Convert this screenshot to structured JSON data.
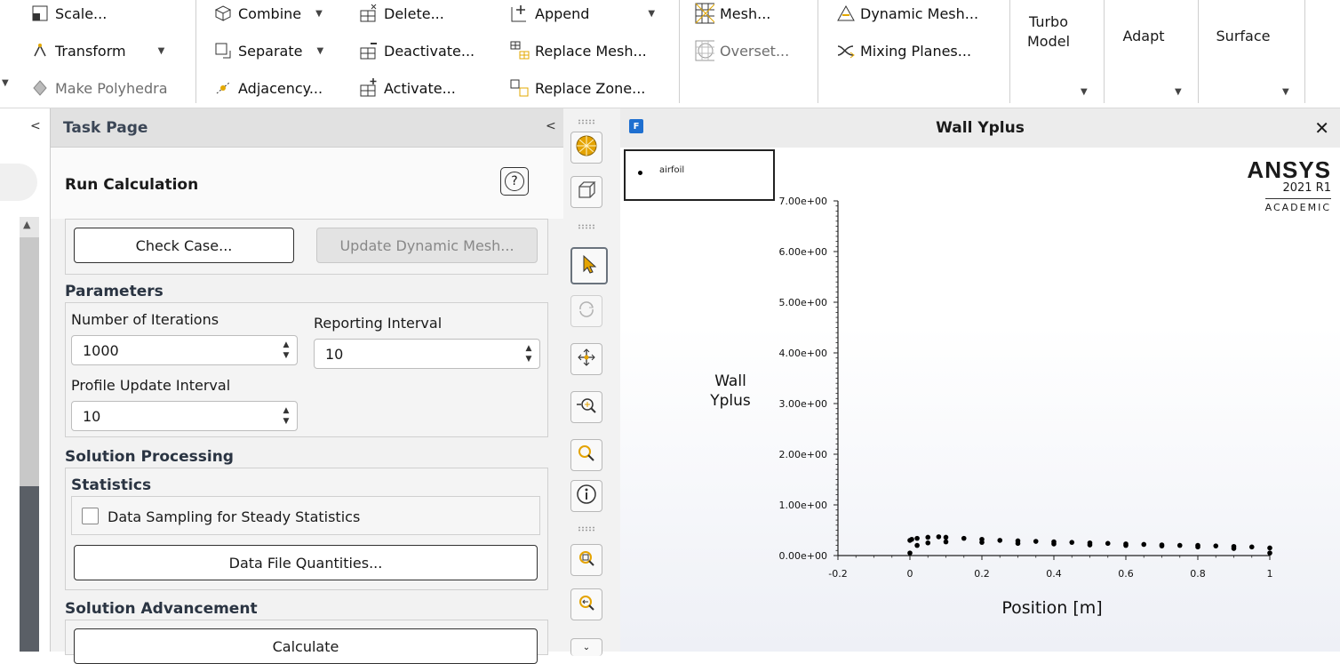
{
  "ribbon": {
    "col1": [
      "Scale...",
      "Transform",
      "Make Polyhedra"
    ],
    "col2": [
      "Combine",
      "Separate",
      "Adjacency..."
    ],
    "col3": [
      "Delete...",
      "Deactivate...",
      "Activate..."
    ],
    "col4": [
      "Append",
      "Replace Mesh...",
      "Replace Zone..."
    ],
    "col5": [
      "Mesh...",
      "Overset..."
    ],
    "col6": [
      "Dynamic Mesh...",
      "Mixing Planes..."
    ],
    "turbo": [
      "Turbo",
      "Model"
    ],
    "adapt": "Adapt",
    "surface": "Surface"
  },
  "task": {
    "header": "Task Page",
    "title": "Run Calculation",
    "help": "?",
    "check_case": "Check Case...",
    "update_dynamic": "Update Dynamic Mesh...",
    "parameters": "Parameters",
    "num_iter_label": "Number of Iterations",
    "num_iter_value": "1000",
    "report_label": "Reporting Interval",
    "report_value": "10",
    "profile_label": "Profile Update Interval",
    "profile_value": "10",
    "solution_processing": "Solution Processing",
    "statistics": "Statistics",
    "data_sampling": "Data Sampling for Steady Statistics",
    "data_file_quantities": "Data File Quantities...",
    "solution_advancement": "Solution Advancement",
    "calculate": "Calculate"
  },
  "graphics": {
    "title": "Wall Yplus",
    "close": "✕",
    "legend_entry": "airfoil",
    "brand": "ANSYS",
    "version": "2021 R1",
    "edition": "ACADEMIC"
  },
  "chart_data": {
    "type": "scatter",
    "title": "Wall Yplus",
    "xlabel": "Position [m]",
    "ylabel": "Wall Yplus",
    "xlim": [
      -0.2,
      1
    ],
    "ylim": [
      0,
      7
    ],
    "x_ticks": [
      "-0.2",
      "0",
      "0.2",
      "0.4",
      "0.6",
      "0.8",
      "1"
    ],
    "y_ticks": [
      "0.00e+00",
      "1.00e+00",
      "2.00e+00",
      "3.00e+00",
      "4.00e+00",
      "5.00e+00",
      "6.00e+00",
      "7.00e+00"
    ],
    "series": [
      {
        "name": "airfoil",
        "x": [
          0,
          0.005,
          0.02,
          0.05,
          0.08,
          0.1,
          0.15,
          0.2,
          0.25,
          0.3,
          0.35,
          0.4,
          0.45,
          0.5,
          0.55,
          0.6,
          0.65,
          0.7,
          0.75,
          0.8,
          0.85,
          0.9,
          0.95,
          1.0,
          0,
          0.02,
          0.05,
          0.1,
          0.2,
          0.3,
          0.4,
          0.5,
          0.6,
          0.7,
          0.8,
          0.9,
          1.0
        ],
        "y": [
          0.3,
          0.32,
          0.34,
          0.36,
          0.37,
          0.36,
          0.34,
          0.32,
          0.3,
          0.29,
          0.28,
          0.27,
          0.26,
          0.25,
          0.24,
          0.23,
          0.22,
          0.21,
          0.2,
          0.2,
          0.19,
          0.18,
          0.17,
          0.15,
          0.05,
          0.2,
          0.25,
          0.27,
          0.26,
          0.24,
          0.23,
          0.21,
          0.2,
          0.19,
          0.17,
          0.14,
          0.05
        ]
      }
    ]
  }
}
